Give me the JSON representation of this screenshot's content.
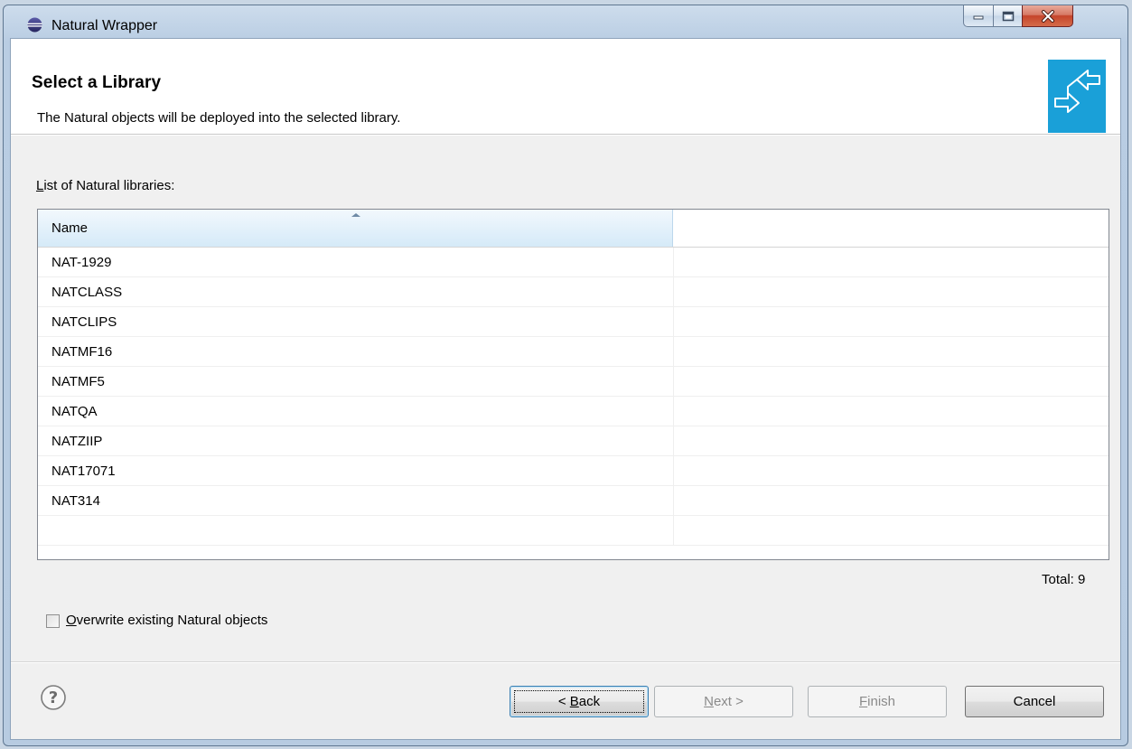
{
  "window": {
    "title": "Natural Wrapper"
  },
  "banner": {
    "title": "Select a Library",
    "description": "The Natural objects will be deployed into the selected library."
  },
  "library_list": {
    "label_mnemonic": "L",
    "label_rest": "ist of Natural libraries:",
    "columns": [
      "Name",
      ""
    ],
    "rows": [
      "NAT-1929",
      "NATCLASS",
      "NATCLIPS",
      "NATMF16",
      "NATMF5",
      "NATQA",
      "NATZIIP",
      "NAT17071",
      "NAT314",
      ""
    ],
    "total": "Total: 9"
  },
  "overwrite": {
    "label_mnemonic": "O",
    "label_rest": "verwrite existing Natural objects",
    "checked": false
  },
  "buttons": {
    "back_prefix": "< ",
    "back_mnemonic": "B",
    "back_rest": "ack",
    "next_mnemonic": "N",
    "next_rest": "ext >",
    "finish_mnemonic": "F",
    "finish_rest": "inish",
    "cancel": "Cancel"
  },
  "colors": {
    "banner_image": "#1aa0d8",
    "header_selected": "#d5eaf8",
    "close_button": "#c5452b"
  },
  "icons": {
    "app": "eclipse-icon",
    "banner": "wrapper-arrows-icon",
    "help": "help-icon",
    "sort": "sort-ascending-icon"
  }
}
